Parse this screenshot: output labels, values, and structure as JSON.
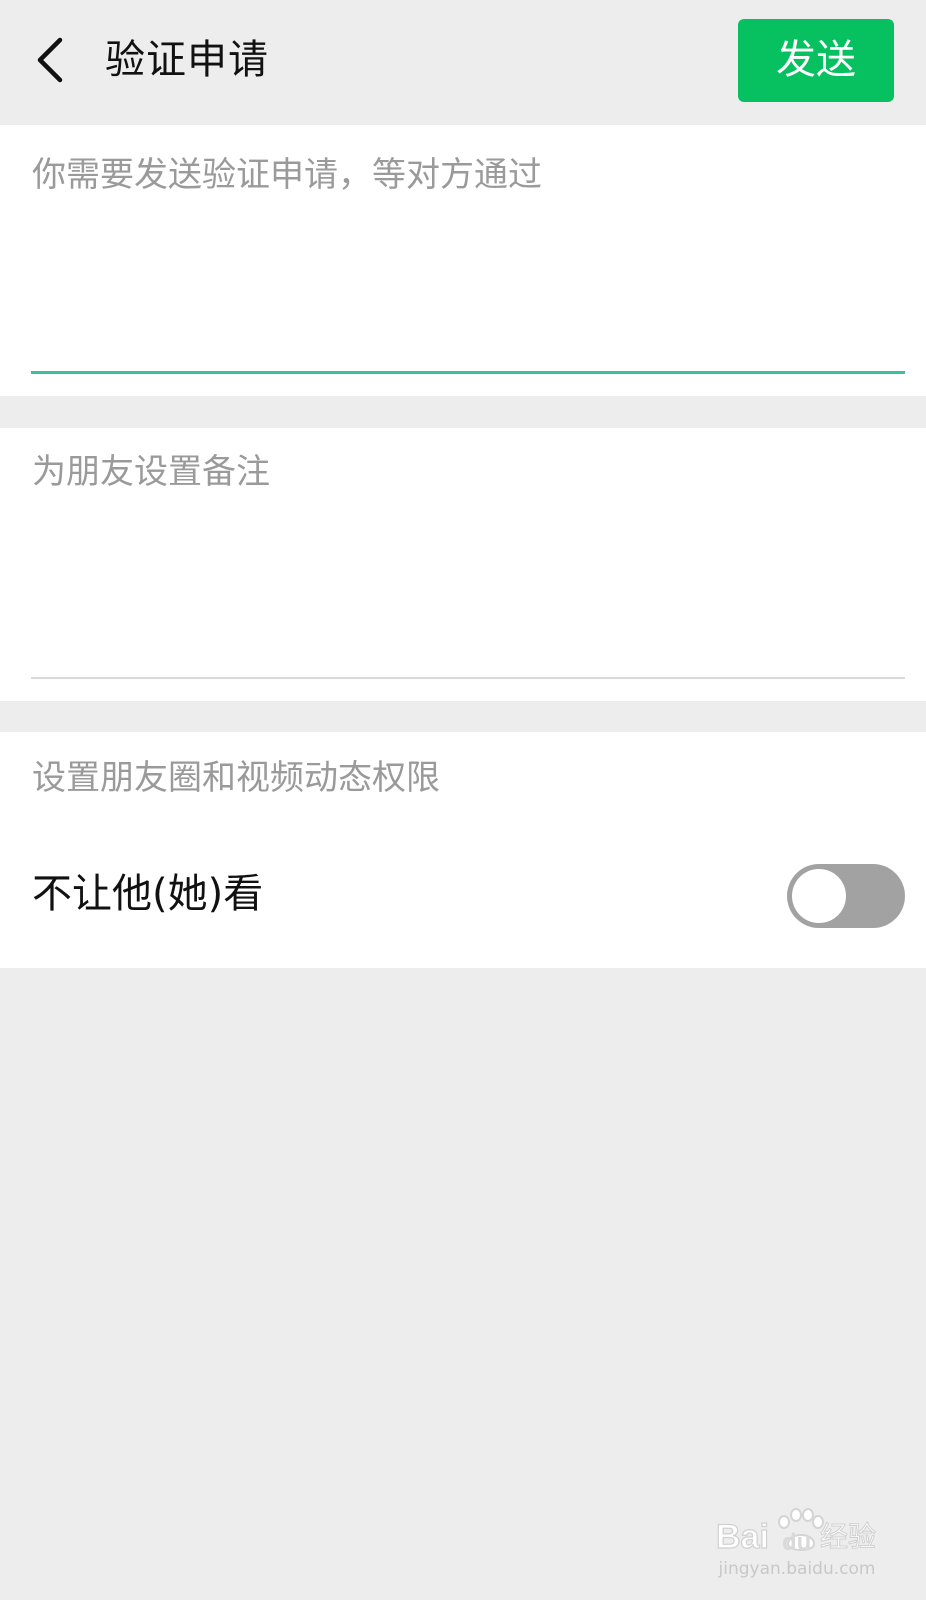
{
  "header": {
    "back_icon": "chevron-left-icon",
    "title": "验证申请",
    "send_label": "发送",
    "send_color": "#07c160"
  },
  "verify_message": {
    "text": "你需要发送验证申请，等对方通过",
    "focused": true,
    "accent_color": "#3ebea0"
  },
  "remark": {
    "placeholder": "为朋友设置备注"
  },
  "permissions": {
    "section_label": "设置朋友圈和视频动态权限",
    "hide_from_label": "不让他(她)看",
    "hide_from_enabled": false
  },
  "watermark": {
    "logo_text": "Baidu经验",
    "site_text": "jingyan.baidu.com"
  }
}
